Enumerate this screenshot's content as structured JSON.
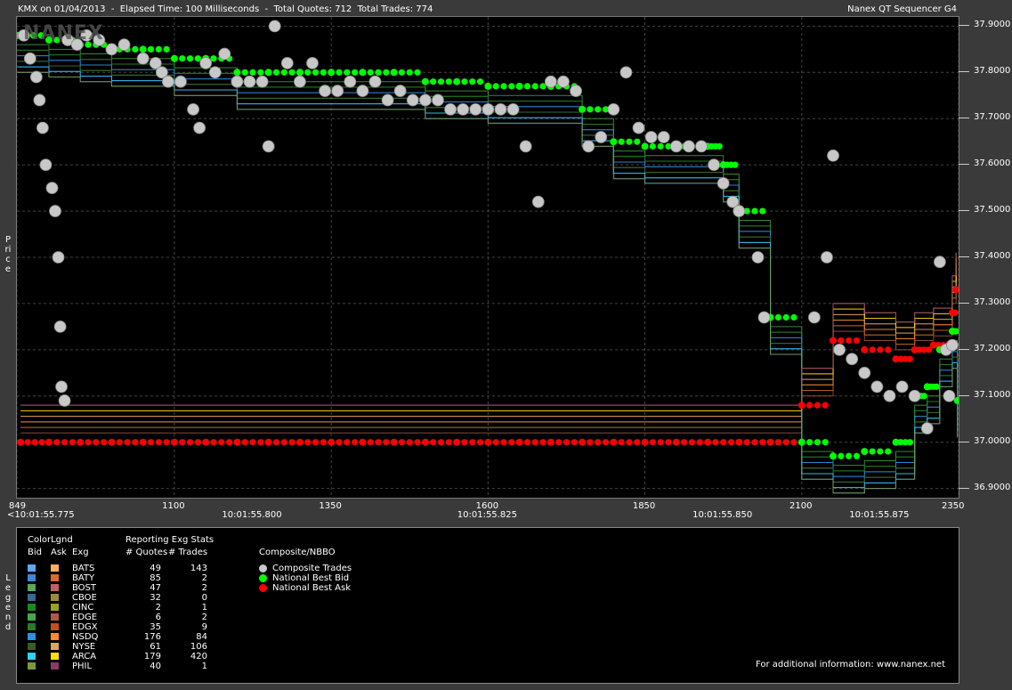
{
  "header": {
    "title_left": "KMX on 01/04/2013  -  Elapsed Time: 100 Milliseconds  -  Total Quotes: 712  Total Trades: 774",
    "title_right": "Nanex QT Sequencer G4"
  },
  "watermark": "NANEX",
  "y_axis_side_label": "Price",
  "legend_side_label": "Legend",
  "chart_data": {
    "type": "scatter",
    "ylim": [
      36.88,
      37.92
    ],
    "xlim": [
      849,
      2350
    ],
    "yticks": [
      "37.9000",
      "37.8000",
      "37.7000",
      "37.6000",
      "37.5000",
      "37.4000",
      "37.3000",
      "37.2000",
      "37.1000",
      "37.0000",
      "36.9000"
    ],
    "xticks": [
      "849",
      "1100",
      "1350",
      "1600",
      "1850",
      "2100",
      "2350"
    ],
    "time_ticks": [
      {
        "label": "<10:01:55.775",
        "x": 849
      },
      {
        "label": "10:01:55.800",
        "x": 1225
      },
      {
        "label": "10:01:55.825",
        "x": 1600
      },
      {
        "label": "10:01:55.850",
        "x": 1975
      },
      {
        "label": "10:01:55.875",
        "x": 2225
      }
    ],
    "series": [
      {
        "name": "Composite Trades",
        "color": "#c8c8c8",
        "points": [
          [
            860,
            37.88
          ],
          [
            870,
            37.83
          ],
          [
            880,
            37.79
          ],
          [
            885,
            37.74
          ],
          [
            890,
            37.68
          ],
          [
            895,
            37.6
          ],
          [
            905,
            37.55
          ],
          [
            910,
            37.5
          ],
          [
            915,
            37.4
          ],
          [
            918,
            37.25
          ],
          [
            920,
            37.12
          ],
          [
            925,
            37.09
          ],
          [
            930,
            37.87
          ],
          [
            945,
            37.86
          ],
          [
            960,
            37.88
          ],
          [
            980,
            37.87
          ],
          [
            1000,
            37.85
          ],
          [
            1020,
            37.86
          ],
          [
            1050,
            37.83
          ],
          [
            1070,
            37.82
          ],
          [
            1080,
            37.8
          ],
          [
            1090,
            37.78
          ],
          [
            1110,
            37.78
          ],
          [
            1130,
            37.72
          ],
          [
            1140,
            37.68
          ],
          [
            1150,
            37.82
          ],
          [
            1165,
            37.8
          ],
          [
            1180,
            37.84
          ],
          [
            1200,
            37.78
          ],
          [
            1220,
            37.78
          ],
          [
            1240,
            37.78
          ],
          [
            1250,
            37.64
          ],
          [
            1260,
            37.9
          ],
          [
            1280,
            37.82
          ],
          [
            1300,
            37.78
          ],
          [
            1320,
            37.82
          ],
          [
            1340,
            37.76
          ],
          [
            1360,
            37.76
          ],
          [
            1380,
            37.78
          ],
          [
            1400,
            37.76
          ],
          [
            1420,
            37.78
          ],
          [
            1440,
            37.74
          ],
          [
            1460,
            37.76
          ],
          [
            1480,
            37.74
          ],
          [
            1500,
            37.74
          ],
          [
            1520,
            37.74
          ],
          [
            1540,
            37.72
          ],
          [
            1560,
            37.72
          ],
          [
            1580,
            37.72
          ],
          [
            1600,
            37.72
          ],
          [
            1620,
            37.72
          ],
          [
            1640,
            37.72
          ],
          [
            1660,
            37.64
          ],
          [
            1680,
            37.52
          ],
          [
            1700,
            37.78
          ],
          [
            1720,
            37.78
          ],
          [
            1740,
            37.76
          ],
          [
            1760,
            37.64
          ],
          [
            1780,
            37.66
          ],
          [
            1800,
            37.72
          ],
          [
            1820,
            37.8
          ],
          [
            1840,
            37.68
          ],
          [
            1860,
            37.66
          ],
          [
            1880,
            37.66
          ],
          [
            1900,
            37.64
          ],
          [
            1920,
            37.64
          ],
          [
            1940,
            37.64
          ],
          [
            1960,
            37.6
          ],
          [
            1975,
            37.56
          ],
          [
            1990,
            37.52
          ],
          [
            2000,
            37.5
          ],
          [
            2030,
            37.4
          ],
          [
            2040,
            37.27
          ],
          [
            2120,
            37.27
          ],
          [
            2140,
            37.4
          ],
          [
            2150,
            37.62
          ],
          [
            2160,
            37.2
          ],
          [
            2180,
            37.18
          ],
          [
            2200,
            37.15
          ],
          [
            2220,
            37.12
          ],
          [
            2240,
            37.1
          ],
          [
            2260,
            37.12
          ],
          [
            2280,
            37.1
          ],
          [
            2300,
            37.03
          ],
          [
            2320,
            37.39
          ],
          [
            2330,
            37.2
          ],
          [
            2335,
            37.1
          ],
          [
            2340,
            37.21
          ]
        ]
      },
      {
        "name": "National Best Bid",
        "color": "#00ff00",
        "points": [
          [
            850,
            37.88
          ],
          [
            900,
            37.87
          ],
          [
            950,
            37.86
          ],
          [
            1000,
            37.85
          ],
          [
            1050,
            37.85
          ],
          [
            1100,
            37.83
          ],
          [
            1150,
            37.83
          ],
          [
            1200,
            37.8
          ],
          [
            1250,
            37.8
          ],
          [
            1300,
            37.8
          ],
          [
            1350,
            37.8
          ],
          [
            1400,
            37.8
          ],
          [
            1450,
            37.8
          ],
          [
            1500,
            37.78
          ],
          [
            1550,
            37.78
          ],
          [
            1600,
            37.77
          ],
          [
            1650,
            37.77
          ],
          [
            1700,
            37.77
          ],
          [
            1750,
            37.72
          ],
          [
            1800,
            37.65
          ],
          [
            1850,
            37.64
          ],
          [
            1900,
            37.64
          ],
          [
            1950,
            37.64
          ],
          [
            1975,
            37.6
          ],
          [
            2000,
            37.5
          ],
          [
            2050,
            37.27
          ],
          [
            2100,
            37.0
          ],
          [
            2150,
            36.97
          ],
          [
            2200,
            36.98
          ],
          [
            2250,
            37.0
          ],
          [
            2280,
            37.1
          ],
          [
            2300,
            37.12
          ],
          [
            2320,
            37.2
          ],
          [
            2340,
            37.24
          ],
          [
            2348,
            37.09
          ]
        ]
      },
      {
        "name": "National Best Ask",
        "color": "#ff0000",
        "points": [
          [
            855,
            37.0
          ],
          [
            900,
            37.0
          ],
          [
            950,
            37.0
          ],
          [
            1000,
            37.0
          ],
          [
            1050,
            37.0
          ],
          [
            1100,
            37.0
          ],
          [
            1150,
            37.0
          ],
          [
            1200,
            37.0
          ],
          [
            1250,
            37.0
          ],
          [
            1300,
            37.0
          ],
          [
            1350,
            37.0
          ],
          [
            1400,
            37.0
          ],
          [
            1450,
            37.0
          ],
          [
            1500,
            37.0
          ],
          [
            1550,
            37.0
          ],
          [
            1600,
            37.0
          ],
          [
            1650,
            37.0
          ],
          [
            1700,
            37.0
          ],
          [
            1750,
            37.0
          ],
          [
            1800,
            37.0
          ],
          [
            1850,
            37.0
          ],
          [
            1900,
            37.0
          ],
          [
            1950,
            37.0
          ],
          [
            2000,
            37.0
          ],
          [
            2050,
            37.0
          ],
          [
            2100,
            37.08
          ],
          [
            2150,
            37.22
          ],
          [
            2200,
            37.2
          ],
          [
            2250,
            37.18
          ],
          [
            2280,
            37.2
          ],
          [
            2310,
            37.21
          ],
          [
            2340,
            37.28
          ],
          [
            2346,
            37.33
          ]
        ]
      }
    ]
  },
  "legend": {
    "colorlegend_title": "ColorLgnd",
    "stats_title": "Reporting Exg Stats",
    "composite_title": "Composite/NBBO",
    "col_bid": "Bid",
    "col_ask": "Ask",
    "col_exg": "Exg",
    "col_quotes": "# Quotes",
    "col_trades": "# Trades",
    "exchanges": [
      {
        "name": "BATS",
        "quotes": "49",
        "trades": "143",
        "bid_color": "#5aa8ff",
        "ask_color": "#ffb060"
      },
      {
        "name": "BATY",
        "quotes": "85",
        "trades": "2",
        "bid_color": "#3a88d8",
        "ask_color": "#d86a30"
      },
      {
        "name": "BOST",
        "quotes": "47",
        "trades": "2",
        "bid_color": "#5aa85a",
        "ask_color": "#c06060"
      },
      {
        "name": "CBOE",
        "quotes": "32",
        "trades": "0",
        "bid_color": "#3a6898",
        "ask_color": "#a08838"
      },
      {
        "name": "CINC",
        "quotes": "2",
        "trades": "1",
        "bid_color": "#1a8a1a",
        "ask_color": "#a0a020"
      },
      {
        "name": "EDGE",
        "quotes": "6",
        "trades": "2",
        "bid_color": "#48a848",
        "ask_color": "#b05848"
      },
      {
        "name": "EDGX",
        "quotes": "35",
        "trades": "9",
        "bid_color": "#2a7a2a",
        "ask_color": "#c05020"
      },
      {
        "name": "NSDQ",
        "quotes": "176",
        "trades": "84",
        "bid_color": "#2a90e8",
        "ask_color": "#ff8830"
      },
      {
        "name": "NYSE",
        "quotes": "61",
        "trades": "106",
        "bid_color": "#3a5a2a",
        "ask_color": "#d8a860"
      },
      {
        "name": "ARCA",
        "quotes": "179",
        "trades": "420",
        "bid_color": "#30d0ff",
        "ask_color": "#ffe000"
      },
      {
        "name": "PHIL",
        "quotes": "40",
        "trades": "1",
        "bid_color": "#7a9a3a",
        "ask_color": "#8a3a6a"
      }
    ],
    "composite_items": [
      {
        "label": "Composite Trades",
        "color": "#c8c8c8"
      },
      {
        "label": "National Best Bid",
        "color": "#00ff00"
      },
      {
        "label": "National Best Ask",
        "color": "#ff0000"
      }
    ],
    "footer": "For additional information: www.nanex.net"
  }
}
